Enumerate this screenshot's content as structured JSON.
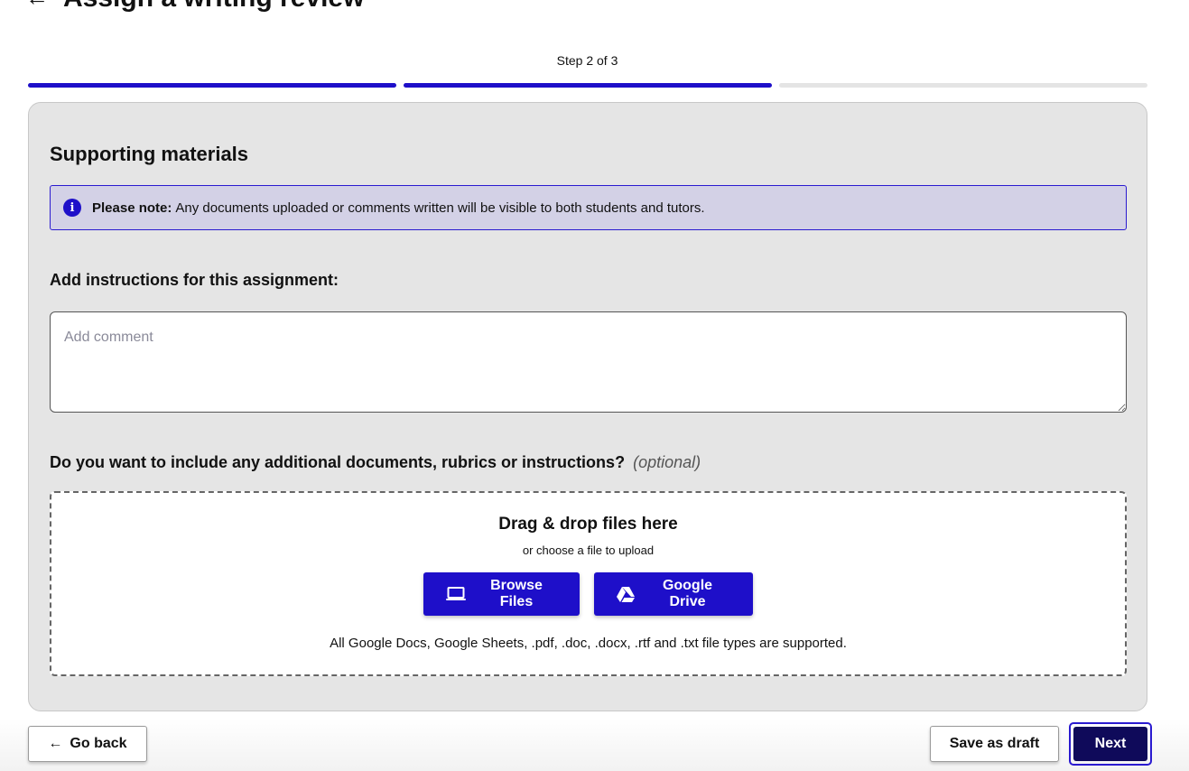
{
  "header": {
    "back_icon": "←",
    "title": "Assign a writing review"
  },
  "stepper": {
    "label": "Step 2 of 3",
    "current_step": 2,
    "total_steps": 3,
    "active_color": "#1e0fc9",
    "inactive_color": "#e4e4e4"
  },
  "panel": {
    "title": "Supporting materials",
    "notice": {
      "icon": "info-icon",
      "bold": "Please note:",
      "text": "Any documents uploaded or comments written will be visible to both students and tutors."
    },
    "instructions_label": "Add instructions for this assignment:",
    "comment_placeholder": "Add comment",
    "comment_value": "",
    "docs_label": "Do you want to include any additional documents, rubrics or instructions?",
    "docs_optional": "(optional)",
    "dropzone": {
      "title": "Drag & drop files here",
      "subtitle": "or choose a file to upload",
      "browse_label": "Browse Files",
      "browse_icon": "laptop-icon",
      "drive_label": "Google Drive",
      "drive_icon": "google-drive-icon",
      "note": "All Google Docs, Google Sheets, .pdf, .doc, .docx, .rtf and .txt file types are supported."
    }
  },
  "footer": {
    "back_label": "Go back",
    "back_icon": "←",
    "draft_label": "Save as draft",
    "next_label": "Next"
  },
  "colors": {
    "accent": "#1e0fc9",
    "next_button": "#0f0a5a",
    "notice_bg": "#d3d1e6"
  }
}
